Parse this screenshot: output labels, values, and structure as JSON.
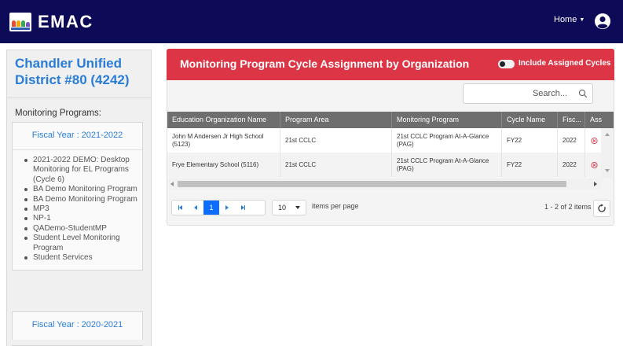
{
  "app": {
    "brand": "EMAC"
  },
  "header": {
    "home_label": "Home",
    "user_icon": "user-circle-icon"
  },
  "sidebar": {
    "org_name": "Chandler Unified District #80 (4242)",
    "monitoring_title": "Monitoring Programs:",
    "fiscal_years": [
      {
        "label": "Fiscal Year : 2021-2022",
        "programs": [
          "2021-2022 DEMO: Desktop Monitoring for EL Programs (Cycle 6)",
          "BA Demo Monitoring Program",
          "BA Demo Monitoring Program",
          "MP3",
          "NP-1",
          "QADemo-StudentMP",
          "Student Level Monitoring Program",
          "Student Services"
        ]
      },
      {
        "label": "Fiscal Year : 2020-2021",
        "programs": []
      }
    ]
  },
  "main": {
    "title": "Monitoring Program Cycle Assignment by Organization",
    "toggle_label": "Include Assigned Cycles",
    "toggle_on": false,
    "search_placeholder": "Search...",
    "columns": [
      "Education Organization Name",
      "Program Area",
      "Monitoring Program",
      "Cycle Name",
      "Fisc...",
      "Ass"
    ],
    "rows": [
      {
        "org": "John M Andersen Jr High School (5123)",
        "area": "21st CCLC",
        "program": "21st CCLC Program At-A-Glance (PAG)",
        "cycle": "FY22",
        "year": "2022"
      },
      {
        "org": "Frye Elementary School (5116)",
        "area": "21st CCLC",
        "program": "21st CCLC Program At-A-Glance (PAG)",
        "cycle": "FY22",
        "year": "2022"
      }
    ],
    "pager": {
      "current_page": "1",
      "page_size": "10",
      "per_page_label": "items per page",
      "count_text": "1 - 2 of 2 items"
    }
  },
  "colors": {
    "navbar": "#0d0b58",
    "header_red": "#dc3545",
    "accent_blue": "#2a7dd6",
    "grid_header": "#6e6e6e"
  }
}
